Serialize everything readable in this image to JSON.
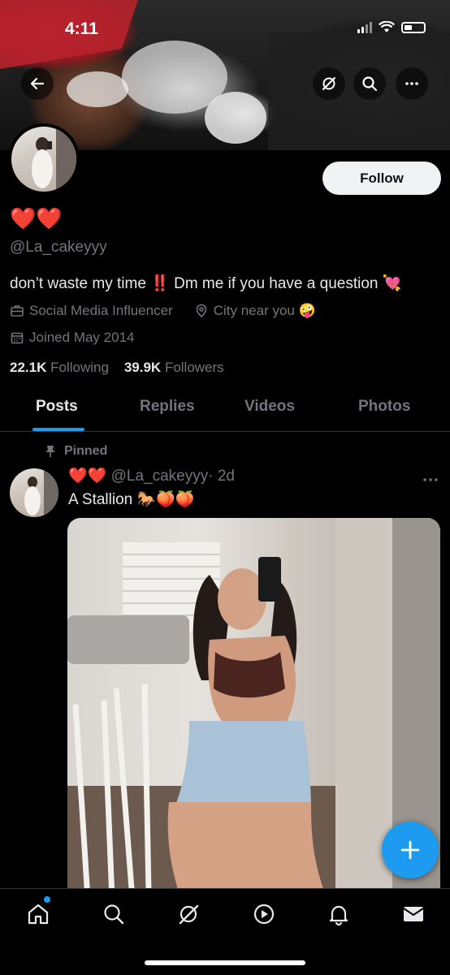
{
  "status_bar": {
    "time": "4:11"
  },
  "profile": {
    "display_name": "❤️❤️",
    "handle": "@La_cakeyyy",
    "bio": "don’t waste my time ‼️ Dm me if you have a question 💘",
    "category": "Social Media Influencer",
    "location": "City near you 🤪",
    "joined": "Joined May 2014",
    "following_count": "22.1K",
    "following_label": "Following",
    "followers_count": "39.9K",
    "followers_label": "Followers",
    "follow_button": "Follow"
  },
  "tabs": [
    {
      "label": "Posts",
      "active": true
    },
    {
      "label": "Replies",
      "active": false
    },
    {
      "label": "Videos",
      "active": false
    },
    {
      "label": "Photos",
      "active": false
    }
  ],
  "pinned_post": {
    "pinned_label": "Pinned",
    "author_name": "❤️❤️",
    "author_handle": "@La_cakeyyy",
    "time": "· 2d",
    "text": "A Stallion 🐎🍑🍑"
  },
  "bottom_nav": {
    "items": [
      "home-icon",
      "search-icon",
      "grok-icon",
      "video-icon",
      "notifications-icon",
      "messages-icon"
    ],
    "active": "home-icon"
  },
  "colors": {
    "accent": "#1d9bf0",
    "background": "#000000",
    "secondary_text": "#71767b",
    "primary_text": "#e7e9ea"
  }
}
